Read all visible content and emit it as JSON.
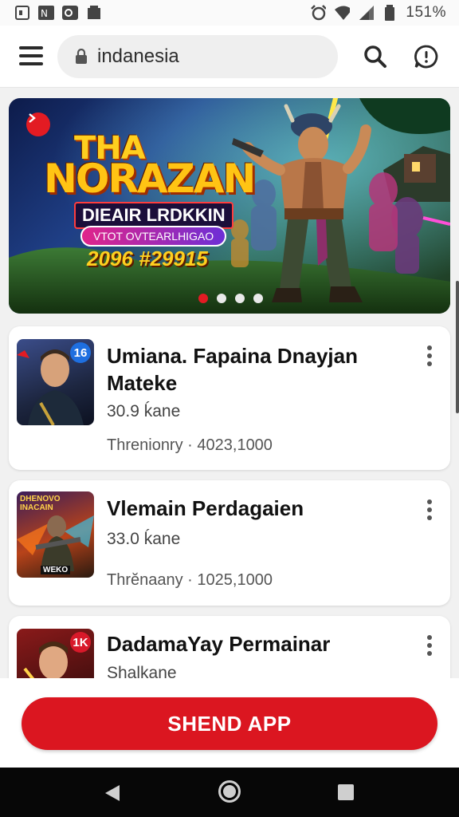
{
  "status_bar": {
    "time": "151%",
    "icons": [
      "screenshot-icon",
      "nfc-icon",
      "cast-icon",
      "sd-card-icon",
      "alarm-icon",
      "wifi-icon",
      "signal-icon",
      "battery-icon"
    ]
  },
  "browser": {
    "url": "indanesia",
    "icons": [
      "menu-icon",
      "lock-icon",
      "search-icon",
      "chat-icon"
    ]
  },
  "banner": {
    "title_line1": "THA",
    "title_line2": "NORAZAN",
    "subtitle": "DIEAIR LRDKKIN",
    "pill_text": "VTOT OVTEARLHIGAO",
    "numbers": "2096 #29915",
    "slide_count": 4,
    "active_slide": 1
  },
  "apps": [
    {
      "title": "Umiana. Fapaina Dnayjan Mateke",
      "size": "30.9 ḱane",
      "meta_label": "Threnionry",
      "meta_value": "4023,1000",
      "badge": "16",
      "badge_color": "#1e6fe0"
    },
    {
      "title": "Vlemain Perdagaien",
      "size": "33.0 ḱane",
      "meta_label": "Thrĕnaany",
      "meta_value": "1025,1000",
      "thumb_top_text": "DHENOVO",
      "thumb_top_text2": "INACAIN",
      "thumb_bottom_text": "WEKO"
    },
    {
      "title": "DadamaYay Permainar",
      "size": "Shalkane",
      "badge": "1K",
      "badge_color": "#d8192a"
    }
  ],
  "cta": {
    "label": "SHEND APP",
    "color": "#db1620"
  },
  "nav": {
    "icons": [
      "back-icon",
      "home-icon",
      "recent-apps-icon"
    ]
  }
}
